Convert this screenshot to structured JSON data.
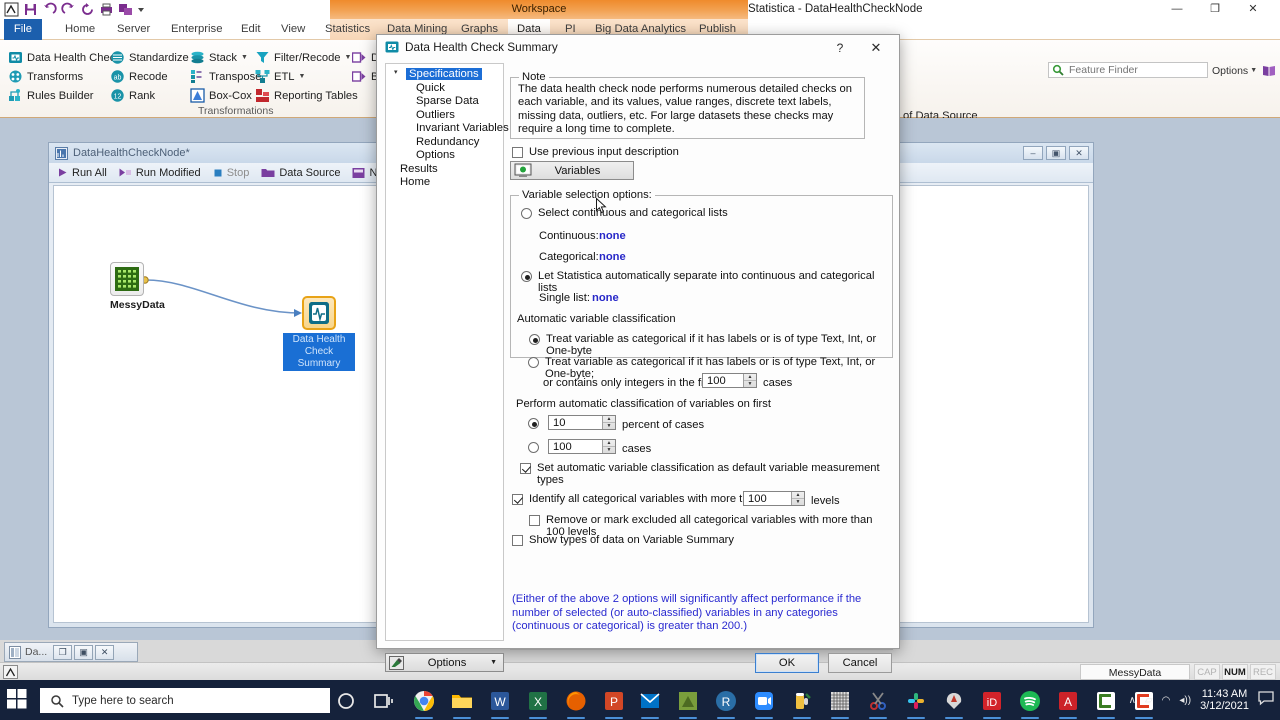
{
  "app": {
    "title": "Statistica - DataHealthCheckNode",
    "window_buttons": [
      {
        "name": "minimize",
        "glyph": "—"
      },
      {
        "name": "maximize",
        "glyph": "❐"
      },
      {
        "name": "close",
        "glyph": "✕"
      }
    ]
  },
  "quick_access": [
    {
      "name": "statistica-logo-icon"
    },
    {
      "name": "save-icon"
    },
    {
      "name": "undo-icon"
    },
    {
      "name": "redo-icon"
    },
    {
      "name": "refresh-icon"
    },
    {
      "name": "print-icon"
    },
    {
      "name": "workbook-icon"
    },
    {
      "name": "qat-dropdown-icon"
    }
  ],
  "contextual": {
    "label": "Workspace"
  },
  "tabs": [
    {
      "label": "File",
      "kind": "file"
    },
    {
      "label": "Home",
      "kind": "normal"
    },
    {
      "label": "Server",
      "kind": "normal"
    },
    {
      "label": "Enterprise",
      "kind": "normal"
    },
    {
      "label": "Edit",
      "kind": "normal"
    },
    {
      "label": "View",
      "kind": "normal"
    },
    {
      "label": "Statistics",
      "kind": "normal"
    },
    {
      "label": "Data Mining",
      "kind": "ctx"
    },
    {
      "label": "Graphs",
      "kind": "ctx"
    },
    {
      "label": "Data",
      "kind": "ctx-selected"
    },
    {
      "label": "PI",
      "kind": "ctx"
    },
    {
      "label": "Big Data Analytics",
      "kind": "ctx"
    },
    {
      "label": "Publish",
      "kind": "ctx"
    }
  ],
  "ribbon": {
    "group_label": "Transformations",
    "items": [
      {
        "label": "Data Health Check",
        "icon": "data-health-check-icon",
        "caret": false
      },
      {
        "label": "Transforms",
        "icon": "transforms-icon",
        "caret": false
      },
      {
        "label": "Rules Builder",
        "icon": "rules-builder-icon",
        "caret": false
      },
      {
        "label": "Standardize",
        "icon": "standardize-icon",
        "caret": false
      },
      {
        "label": "Recode",
        "icon": "recode-icon",
        "caret": false
      },
      {
        "label": "Rank",
        "icon": "rank-icon",
        "caret": false
      },
      {
        "label": "Stack",
        "icon": "stack-icon",
        "caret": true
      },
      {
        "label": "Transpose",
        "icon": "transpose-icon",
        "caret": false
      },
      {
        "label": "Box-Cox",
        "icon": "box-cox-icon",
        "caret": false
      },
      {
        "label": "Filter/Recode",
        "icon": "filter-recode-icon",
        "caret": true
      },
      {
        "label": "ETL",
        "icon": "etl-icon",
        "caret": true
      },
      {
        "label": "Reporting Tables",
        "icon": "reporting-tables-icon",
        "caret": false
      }
    ],
    "obscured_items": [
      {
        "label": "D",
        "icon": "deploy-icon"
      },
      {
        "label": "Ba",
        "icon": "batch-icon"
      }
    ],
    "right_fragment": "of Data Source"
  },
  "feature_finder": {
    "placeholder": "Feature Finder",
    "icon": "search-icon",
    "options_label": "Options",
    "options_icon": "options-book-icon"
  },
  "workspace": {
    "title": "DataHealthCheckNode*",
    "icon": "workspace-doc-icon",
    "window_buttons": [
      {
        "name": "minimize",
        "glyph": "–"
      },
      {
        "name": "restore",
        "glyph": "▣"
      },
      {
        "name": "close",
        "glyph": "✕"
      }
    ],
    "toolbar": [
      {
        "label": "Run All",
        "icon": "play-icon",
        "dim": false
      },
      {
        "label": "Run Modified",
        "icon": "play-modified-icon",
        "dim": false
      },
      {
        "label": "Stop",
        "icon": "stop-icon",
        "dim": true
      },
      {
        "label": "Data Source",
        "icon": "folder-icon",
        "dim": false
      },
      {
        "label": "Node B",
        "icon": "node-browser-icon",
        "dim": false
      }
    ],
    "nodes": [
      {
        "name": "data-source-node",
        "label": "MessyData",
        "icon": "spreadsheet-icon",
        "selected": false
      },
      {
        "name": "analysis-node",
        "label": "Data Health\nCheck Summary",
        "label_line1": "Data Health",
        "label_line2": "Check Summary",
        "icon": "health-check-node-icon",
        "selected": true
      }
    ]
  },
  "dialog": {
    "title": "Data Health Check Summary",
    "icon": "data-health-check-icon",
    "help_glyph": "?",
    "close_glyph": "✕",
    "nav": [
      {
        "label": "Specifications",
        "level": 1,
        "selected": true
      },
      {
        "label": "Quick",
        "level": 2,
        "selected": false
      },
      {
        "label": "Sparse Data",
        "level": 2,
        "selected": false
      },
      {
        "label": "Outliers",
        "level": 2,
        "selected": false
      },
      {
        "label": "Invariant Variables",
        "level": 2,
        "selected": false
      },
      {
        "label": "Redundancy",
        "level": 2,
        "selected": false
      },
      {
        "label": "Options",
        "level": 2,
        "selected": false
      },
      {
        "label": "Results",
        "level": 1,
        "selected": false
      },
      {
        "label": "Home",
        "level": 1,
        "selected": false
      }
    ],
    "note": {
      "legend": "Note",
      "text": "The data health check node performs numerous detailed checks on each variable, and its values, value ranges, discrete text labels, missing data, outliers, etc.  For large datasets these checks may require a long time to complete."
    },
    "use_previous_input": {
      "label": "Use previous input description",
      "checked": false
    },
    "variables_button": {
      "label": "Variables",
      "icon": "variables-icon"
    },
    "variable_selection": {
      "legend": "Variable selection options:",
      "radio_select_lists": {
        "label": "Select continuous and categorical lists",
        "checked": false
      },
      "continuous": {
        "label": "Continuous:",
        "value": "none"
      },
      "categorical": {
        "label": "Categorical:",
        "value": "none"
      },
      "radio_auto": {
        "label": "Let Statistica automatically separate into continuous and categorical lists",
        "checked": true
      },
      "single_list": {
        "label": "Single list:",
        "value": "none"
      },
      "auto_classification_label": "Automatic variable classification",
      "radio_labels_only": {
        "label": "Treat variable as categorical if it has labels or is of type Text, Int, or One-byte",
        "checked": true
      },
      "radio_labels_integers": {
        "label": "Treat variable as categorical if it has labels or is of type Text, Int, or One-byte;",
        "label2_prefix": "or contains only integers in the first",
        "label2_suffix": "cases",
        "value": "100",
        "checked": false
      },
      "perform_label": "Perform automatic classification of variables on first",
      "percent_option": {
        "value": "10",
        "suffix": "percent of cases",
        "checked": true
      },
      "cases_option": {
        "value": "100",
        "suffix": "cases",
        "checked": false
      },
      "set_default": {
        "label": "Set automatic variable classification as default variable measurement types",
        "checked": true
      }
    },
    "identify_levels": {
      "prefix": "Identify all categorical variables with more than",
      "value": "100",
      "suffix": "levels",
      "checked": true
    },
    "remove_levels": {
      "label": "Remove or mark excluded all categorical variables with more than  100  levels",
      "checked": false
    },
    "show_types": {
      "label": "Show types of data on Variable Summary",
      "checked": false
    },
    "perf_note": "(Either of the above 2 options will significantly affect performance if the number of selected (or auto-classified) variables in any categories (continuous or categorical) is greater than 200.)",
    "options_button": {
      "label": "Options",
      "icon": "options-icon",
      "caret": "▼"
    },
    "ok_button": "OK",
    "cancel_button": "Cancel"
  },
  "status_bar": {
    "doc_tab": {
      "label": "Da...",
      "icon": "document-icon"
    },
    "doc_buttons": [
      {
        "name": "restore",
        "glyph": "❐"
      },
      {
        "name": "maximize",
        "glyph": "▣"
      },
      {
        "name": "close",
        "glyph": "✕"
      }
    ],
    "left_icon": "statistica-icon",
    "document_name": "MessyData",
    "indicators": [
      {
        "label": "CAP",
        "active": false
      },
      {
        "label": "NUM",
        "active": true
      },
      {
        "label": "REC",
        "active": false
      }
    ]
  },
  "taskbar": {
    "start_icon": "windows-start-icon",
    "search_placeholder": "Type here to search",
    "search_icon": "search-icon",
    "pinned": [
      {
        "name": "cortana-icon",
        "color": "#15223b",
        "glyph": "○"
      },
      {
        "name": "task-view-icon",
        "color": "#15223b",
        "glyph": "⌸"
      },
      {
        "name": "chrome-icon",
        "color": "#f4b400"
      },
      {
        "name": "file-explorer-icon",
        "color": "#ffb900"
      },
      {
        "name": "word-icon",
        "color": "#2b579a"
      },
      {
        "name": "excel-icon",
        "color": "#207245"
      },
      {
        "name": "firefox-icon",
        "color": "#e66000"
      },
      {
        "name": "powerpoint-icon",
        "color": "#d24726"
      },
      {
        "name": "outlook-icon",
        "color": "#0072c6"
      },
      {
        "name": "notes-icon",
        "color": "#7a9e3c"
      },
      {
        "name": "r-studio-icon",
        "color": "#2a6ea6"
      },
      {
        "name": "zoom-icon",
        "color": "#2d8cff"
      },
      {
        "name": "beer-icon",
        "color": "#d4a017"
      },
      {
        "name": "statistica-icon",
        "color": "#7a7a7a"
      },
      {
        "name": "snip-icon",
        "color": "#b03030"
      },
      {
        "name": "slack-icon",
        "color": "#4a154b"
      },
      {
        "name": "paint-icon",
        "color": "#b8452e"
      },
      {
        "name": "id-icon",
        "color": "#d2232a"
      },
      {
        "name": "spotify-icon",
        "color": "#1db954"
      },
      {
        "name": "acrobat-icon",
        "color": "#cc2229"
      },
      {
        "name": "camtasia-icon",
        "color": "#3a7d22"
      },
      {
        "name": "camtasia-editor-icon",
        "color": "#e03c20"
      }
    ],
    "tray": [
      {
        "name": "show-hidden-icons",
        "glyph": "∧"
      },
      {
        "name": "onedrive-icon",
        "glyph": "▱"
      },
      {
        "name": "network-icon",
        "glyph": "◠"
      },
      {
        "name": "volume-icon",
        "glyph": "◂))"
      }
    ],
    "clock_time": "11:43 AM",
    "clock_date": "3/12/2021",
    "action_center_icon": "action-center-icon"
  },
  "colors": {
    "ribbon_accent": "#ef8b2c",
    "file_tab": "#1c5fad",
    "selection_blue": "#1c6ed6",
    "value_blue": "#2727c8",
    "note_blue": "#2a2ad0",
    "teal_icon": "#0f6d86",
    "taskbar": "#15223b"
  }
}
